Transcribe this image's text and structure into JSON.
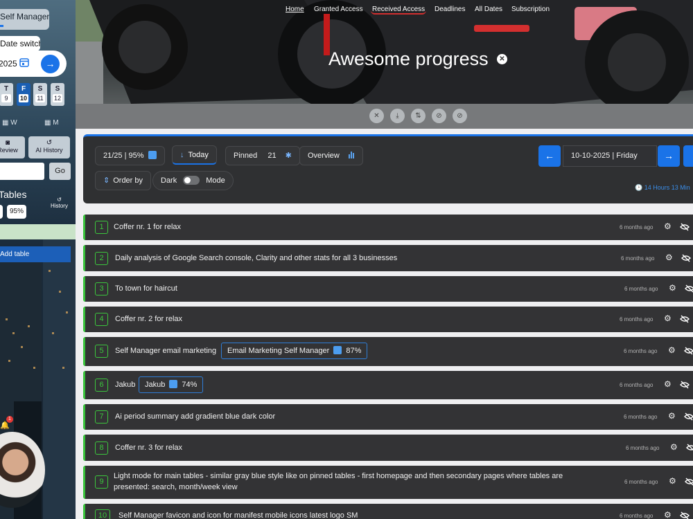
{
  "sidebar": {
    "app_title": "Self Manager",
    "date_switcher_label": "Date switcher",
    "date_value": "2025",
    "go_arrow": "→",
    "days": [
      {
        "letter": "T",
        "num": "9"
      },
      {
        "letter": "F",
        "num": "10"
      },
      {
        "letter": "S",
        "num": "11"
      },
      {
        "letter": "S",
        "num": "12"
      }
    ],
    "view_week": "W",
    "view_month": "M",
    "review_label": "Review",
    "ai_history_label": "AI History",
    "search_go": "Go",
    "tables_label": "Tables",
    "history_label": "History",
    "percent_pill": "95%",
    "add_table_label": "Add table",
    "notif_count": "1"
  },
  "nav": {
    "home": "Home",
    "granted": "Granted Access",
    "received": "Received Access",
    "deadlines": "Deadlines",
    "all_dates": "All Dates",
    "subscription": "Subscription"
  },
  "hero": {
    "title": "Awesome progress",
    "close": "✕",
    "tools": [
      "✕",
      "⤓",
      "⇅",
      "⊘",
      "⊘"
    ]
  },
  "toolbar": {
    "progress_label": "21/25 | 95%",
    "today_label": "Today",
    "today_arrow": "↓",
    "pinned_label": "Pinned",
    "pinned_count": "21",
    "pin_icon": "✱",
    "overview_label": "Overview",
    "order_label": "Order by",
    "order_icon": "⇕",
    "dark_label": "Dark",
    "mode_label": "Mode",
    "prev": "←",
    "next": "→",
    "date_text": "10-10-2025   |   Friday",
    "timer_text": "🕑 14 Hours 13 Min"
  },
  "tasks": [
    {
      "n": "1",
      "text": "Coffer nr. 1 for relax",
      "ago": "6 months ago"
    },
    {
      "n": "2",
      "text": "Daily analysis of Google Search console, Clarity and other stats for all 3 businesses",
      "ago": "6 months ago"
    },
    {
      "n": "3",
      "text": "To town for haircut",
      "ago": "6 months ago"
    },
    {
      "n": "4",
      "text": "Coffer nr. 2 for relax",
      "ago": "6 months ago"
    },
    {
      "n": "5",
      "text": "Self Manager email marketing",
      "ago": "6 months ago",
      "tag": "Email Marketing Self Manager",
      "tag_pct": "87%"
    },
    {
      "n": "6",
      "text": "Jakub",
      "ago": "6 months ago",
      "tag": "Jakub",
      "tag_pct": "74%"
    },
    {
      "n": "7",
      "text": "Ai period summary add gradient blue dark color",
      "ago": "6 months ago"
    },
    {
      "n": "8",
      "text": "Coffer nr. 3 for relax",
      "ago": "6 months ago"
    },
    {
      "n": "9",
      "text": "Light mode for main tables - similar gray blue style like on pinned tables - first homepage and then secondary pages where tables are presented: search, month/week view",
      "ago": "6 months ago"
    },
    {
      "n": "10",
      "text": "Self Manager favicon and icon for manifest mobile icons latest logo SM",
      "ago": "6 months ago"
    }
  ],
  "colors": {
    "accent": "#1a73e8",
    "done_green": "#38c23a",
    "row_bg": "#333335"
  }
}
